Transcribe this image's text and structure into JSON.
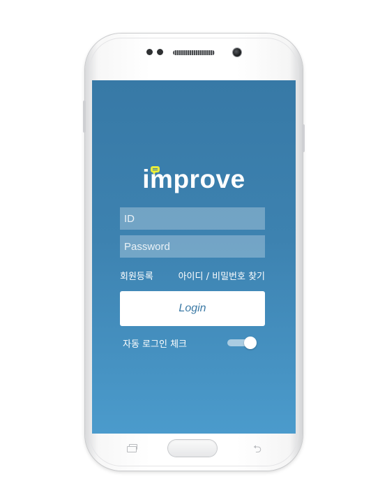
{
  "app": {
    "logo_text": "improve",
    "brand_colors": {
      "screen_top": "#3779a6",
      "screen_bottom": "#4b9bcc",
      "accent_bubble": "#e7ec3a",
      "login_text": "#3b79a5"
    }
  },
  "login": {
    "id_placeholder": "ID",
    "password_placeholder": "Password",
    "register_link": "회원등록",
    "find_link": "아이디 / 비밀번호 찾기",
    "login_button": "Login",
    "auto_login_label": "자동 로그인 체크",
    "auto_login_enabled": true
  },
  "hardware": {
    "icons": [
      "recent-apps-icon",
      "home-button",
      "back-icon"
    ]
  }
}
